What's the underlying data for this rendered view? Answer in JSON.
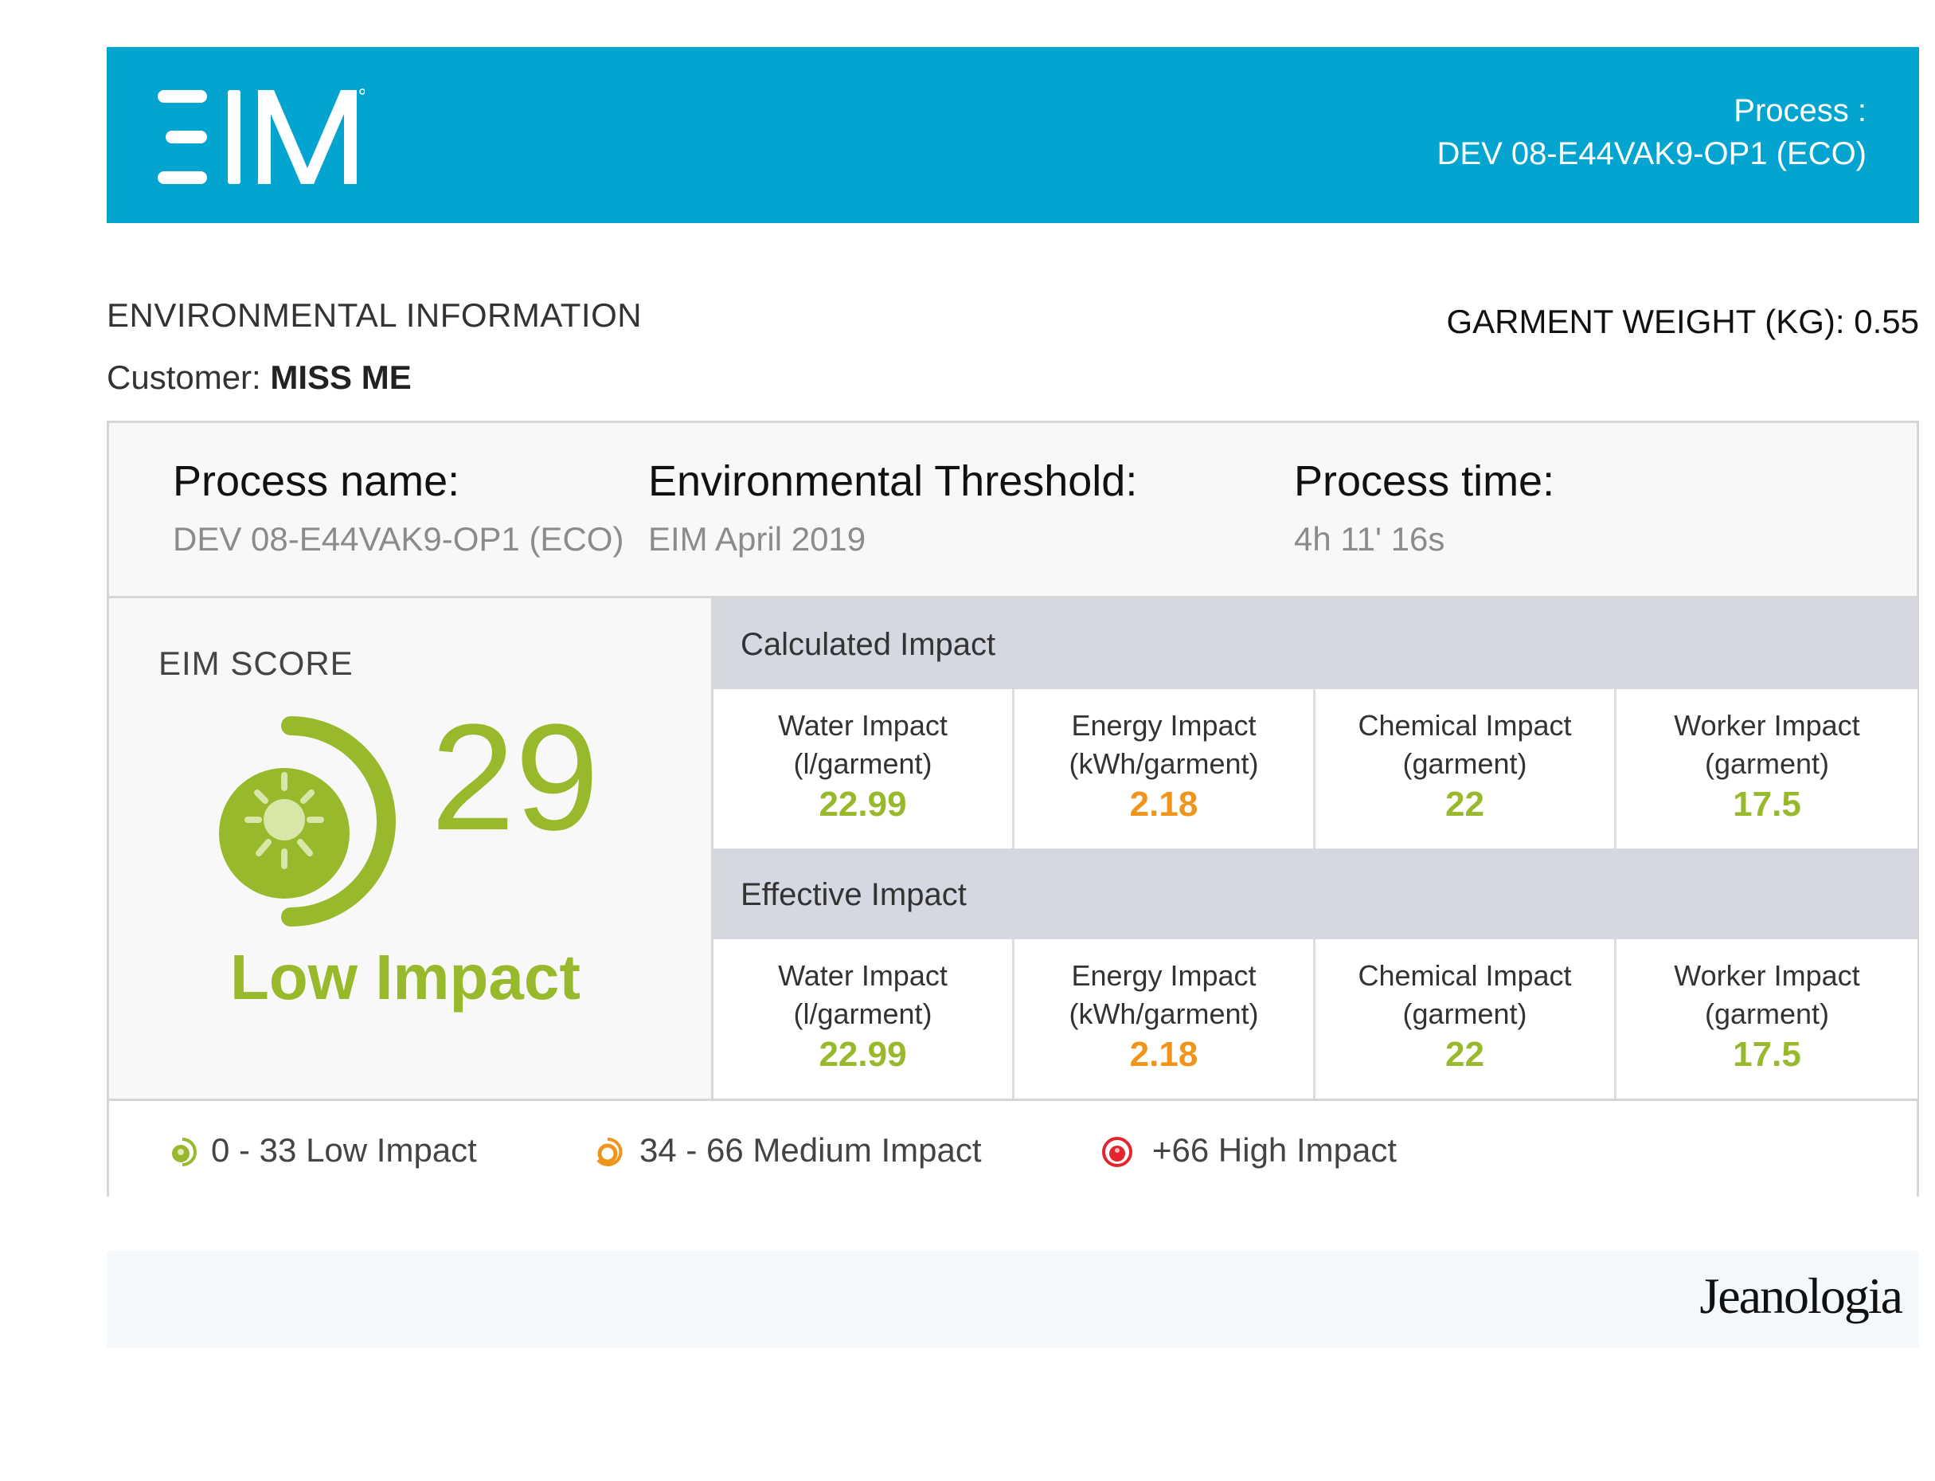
{
  "header": {
    "logo_text": "EIM",
    "process_label": "Process :",
    "process_code": "DEV 08-E44VAK9-OP1 (ECO)"
  },
  "section": {
    "title": "ENVIRONMENTAL INFORMATION",
    "customer_label": "Customer: ",
    "customer_name": "MISS ME",
    "garment_weight": "GARMENT WEIGHT (KG): 0.55"
  },
  "process": {
    "name_label": "Process name:",
    "name_value": "DEV 08-E44VAK9-OP1 (ECO)",
    "threshold_label": "Environmental Threshold:",
    "threshold_value": "EIM April 2019",
    "time_label": "Process time:",
    "time_value": "4h 11' 16s"
  },
  "score": {
    "title": "EIM SCORE",
    "value": "29",
    "level": "Low Impact",
    "color": "#98b92b"
  },
  "calculated": {
    "title": "Calculated Impact",
    "cells": [
      {
        "line1": "Water Impact",
        "line2": "(l/garment)",
        "value": "22.99"
      },
      {
        "line1": "Energy Impact",
        "line2": "(kWh/garment)",
        "value": "2.18"
      },
      {
        "line1": "Chemical Impact",
        "line2": "(garment)",
        "value": "22"
      },
      {
        "line1": "Worker Impact",
        "line2": "(garment)",
        "value": "17.5"
      }
    ]
  },
  "effective": {
    "title": "Effective Impact",
    "cells": [
      {
        "line1": "Water Impact",
        "line2": "(l/garment)",
        "value": "22.99"
      },
      {
        "line1": "Energy Impact",
        "line2": "(kWh/garment)",
        "value": "2.18"
      },
      {
        "line1": "Chemical Impact",
        "line2": "(garment)",
        "value": "22"
      },
      {
        "line1": "Worker Impact",
        "line2": "(garment)",
        "value": "17.5"
      }
    ]
  },
  "legend": {
    "low": "0 - 33 Low Impact",
    "medium": "34 - 66 Medium Impact",
    "high": "+66 High Impact",
    "colors": {
      "low": "#98b92b",
      "medium": "#f0951c",
      "high": "#e3262d"
    }
  },
  "footer": {
    "brand": "Jeanologia"
  }
}
